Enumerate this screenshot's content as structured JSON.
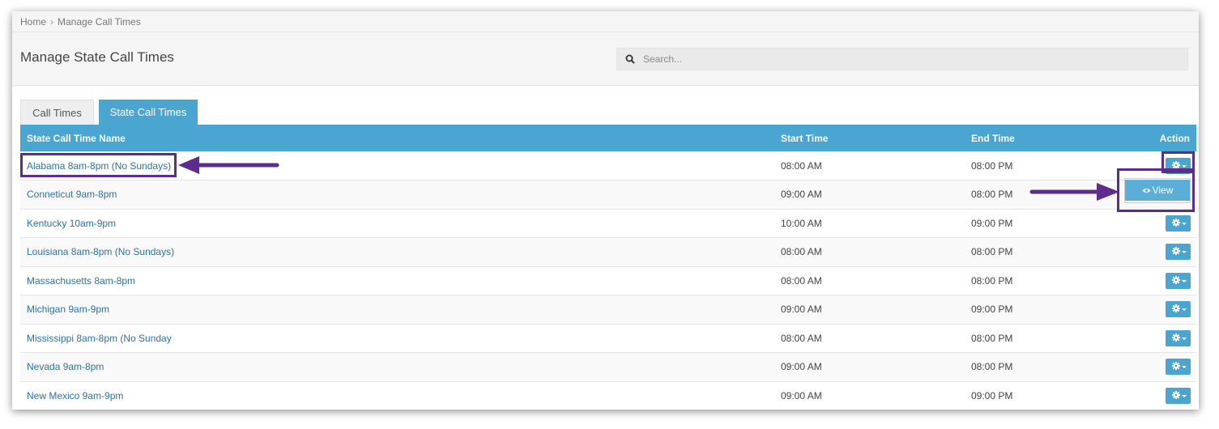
{
  "breadcrumb": {
    "home": "Home",
    "separator": "›",
    "current": "Manage Call Times"
  },
  "page": {
    "title": "Manage State Call Times"
  },
  "search": {
    "placeholder": "Search..."
  },
  "tabs": [
    {
      "label": "Call Times",
      "active": false
    },
    {
      "label": "State Call Times",
      "active": true
    }
  ],
  "table": {
    "headers": {
      "name": "State Call Time Name",
      "start": "Start Time",
      "end": "End Time",
      "action": "Action"
    },
    "rows": [
      {
        "name": "Alabama 8am-8pm (No Sundays)",
        "start": "08:00 AM",
        "end": "08:00 PM"
      },
      {
        "name": "Conneticut 9am-8pm",
        "start": "09:00 AM",
        "end": "08:00 PM"
      },
      {
        "name": "Kentucky 10am-9pm",
        "start": "10:00 AM",
        "end": "09:00 PM"
      },
      {
        "name": "Louisiana 8am-8pm (No Sundays)",
        "start": "08:00 AM",
        "end": "08:00 PM"
      },
      {
        "name": "Massachusetts 8am-8pm",
        "start": "08:00 AM",
        "end": "08:00 PM"
      },
      {
        "name": "Michigan 9am-9pm",
        "start": "09:00 AM",
        "end": "09:00 PM"
      },
      {
        "name": "Mississippi 8am-8pm (No Sunday",
        "start": "08:00 AM",
        "end": "08:00 PM"
      },
      {
        "name": "Nevada 9am-8pm",
        "start": "09:00 AM",
        "end": "08:00 PM"
      },
      {
        "name": "New Mexico 9am-9pm",
        "start": "09:00 AM",
        "end": "09:00 PM"
      }
    ]
  },
  "dropdown": {
    "view_label": "View"
  },
  "icons": {
    "search": "search-icon",
    "gear": "gear-icon",
    "caret": "caret-down-icon",
    "eye": "eye-icon",
    "arrow": "arrow-annotation"
  },
  "colors": {
    "accent": "#4aa5d1",
    "link": "#2a73a8",
    "annotation": "#5d2d8e"
  }
}
